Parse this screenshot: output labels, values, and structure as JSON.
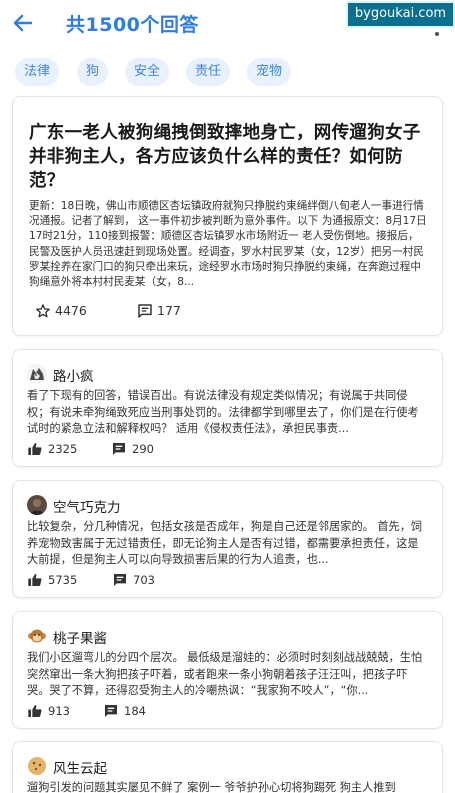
{
  "header": {
    "title": "共1500个回答",
    "watermark": "bygoukai.com"
  },
  "tags": [
    "法律",
    "狗",
    "安全",
    "责任",
    "宠物"
  ],
  "question": {
    "title": "广东一老人被狗绳拽倒致摔地身亡，网传遛狗女子并非狗主人，各方应该负什么样的责任？如何防范？",
    "description": "更新：18日晚，佛山市顺德区杏坛镇政府就狗只挣脱约束绳绊倒八旬老人一事进行情况通报。记者了解到， 这一事件初步被判断为意外事件。以下 为通报原文：8月17日17时21分，110接到报警：顺德区杏坛镇罗水市场附近一 老人受伤倒地。接报后，民警及医护人员迅速赶到现场处置。经调查，罗水村民罗某（女，12岁）把另一村民罗某拴养在家门口的狗只牵出来玩，途经罗水市场时狗只挣脱约束绳，在奔跑过程中狗绳意外将本村村民麦某（女，8...",
    "stars": "4476",
    "comments": "177"
  },
  "answers": [
    {
      "name": "路小疯",
      "avatar": "wolf-avatar",
      "text": "看了下现有的回答，错误百出。有说法律没有规定类似情况；有说属于共同侵权；有说未牵狗绳致死应当刑事处罚的。法律都学到哪里去了，你们是在行使考试时的紧急立法和解释权吗？ 适用《侵权责任法》，承担民事责...",
      "likes": "2325",
      "comments": "290"
    },
    {
      "name": "空气巧克力",
      "avatar": "photo-avatar",
      "text": "比较复杂，分几种情况，包括女孩是否成年，狗是自己还是邻居家的。 首先，饲养宠物致害属于无过错责任，即无论狗主人是否有过错，都需要承担责任，这是大前提，但是狗主人可以向导致损害后果的行为人追责，也...",
      "likes": "5735",
      "comments": "703"
    },
    {
      "name": "桃子果酱",
      "avatar": "monkey-avatar",
      "text": "我们小区遛弯儿的分四个层次。 最低级是溜娃的：必须时时刻刻战战兢兢，生怕突然窜出一条大狗把孩子吓着，或者跑来一条小狗朝着孩子汪汪叫，把孩子吓哭。哭了不算，还得忍受狗主人的冷嘲热讽：“我家狗不咬人”，“你...",
      "likes": "913",
      "comments": "184"
    },
    {
      "name": "风生云起",
      "avatar": "cookie-avatar",
      "text": "遛狗引发的问题其实屡见不鲜了 案例一 爷爷护孙心切将狗踢死 狗主人推到"
    }
  ]
}
